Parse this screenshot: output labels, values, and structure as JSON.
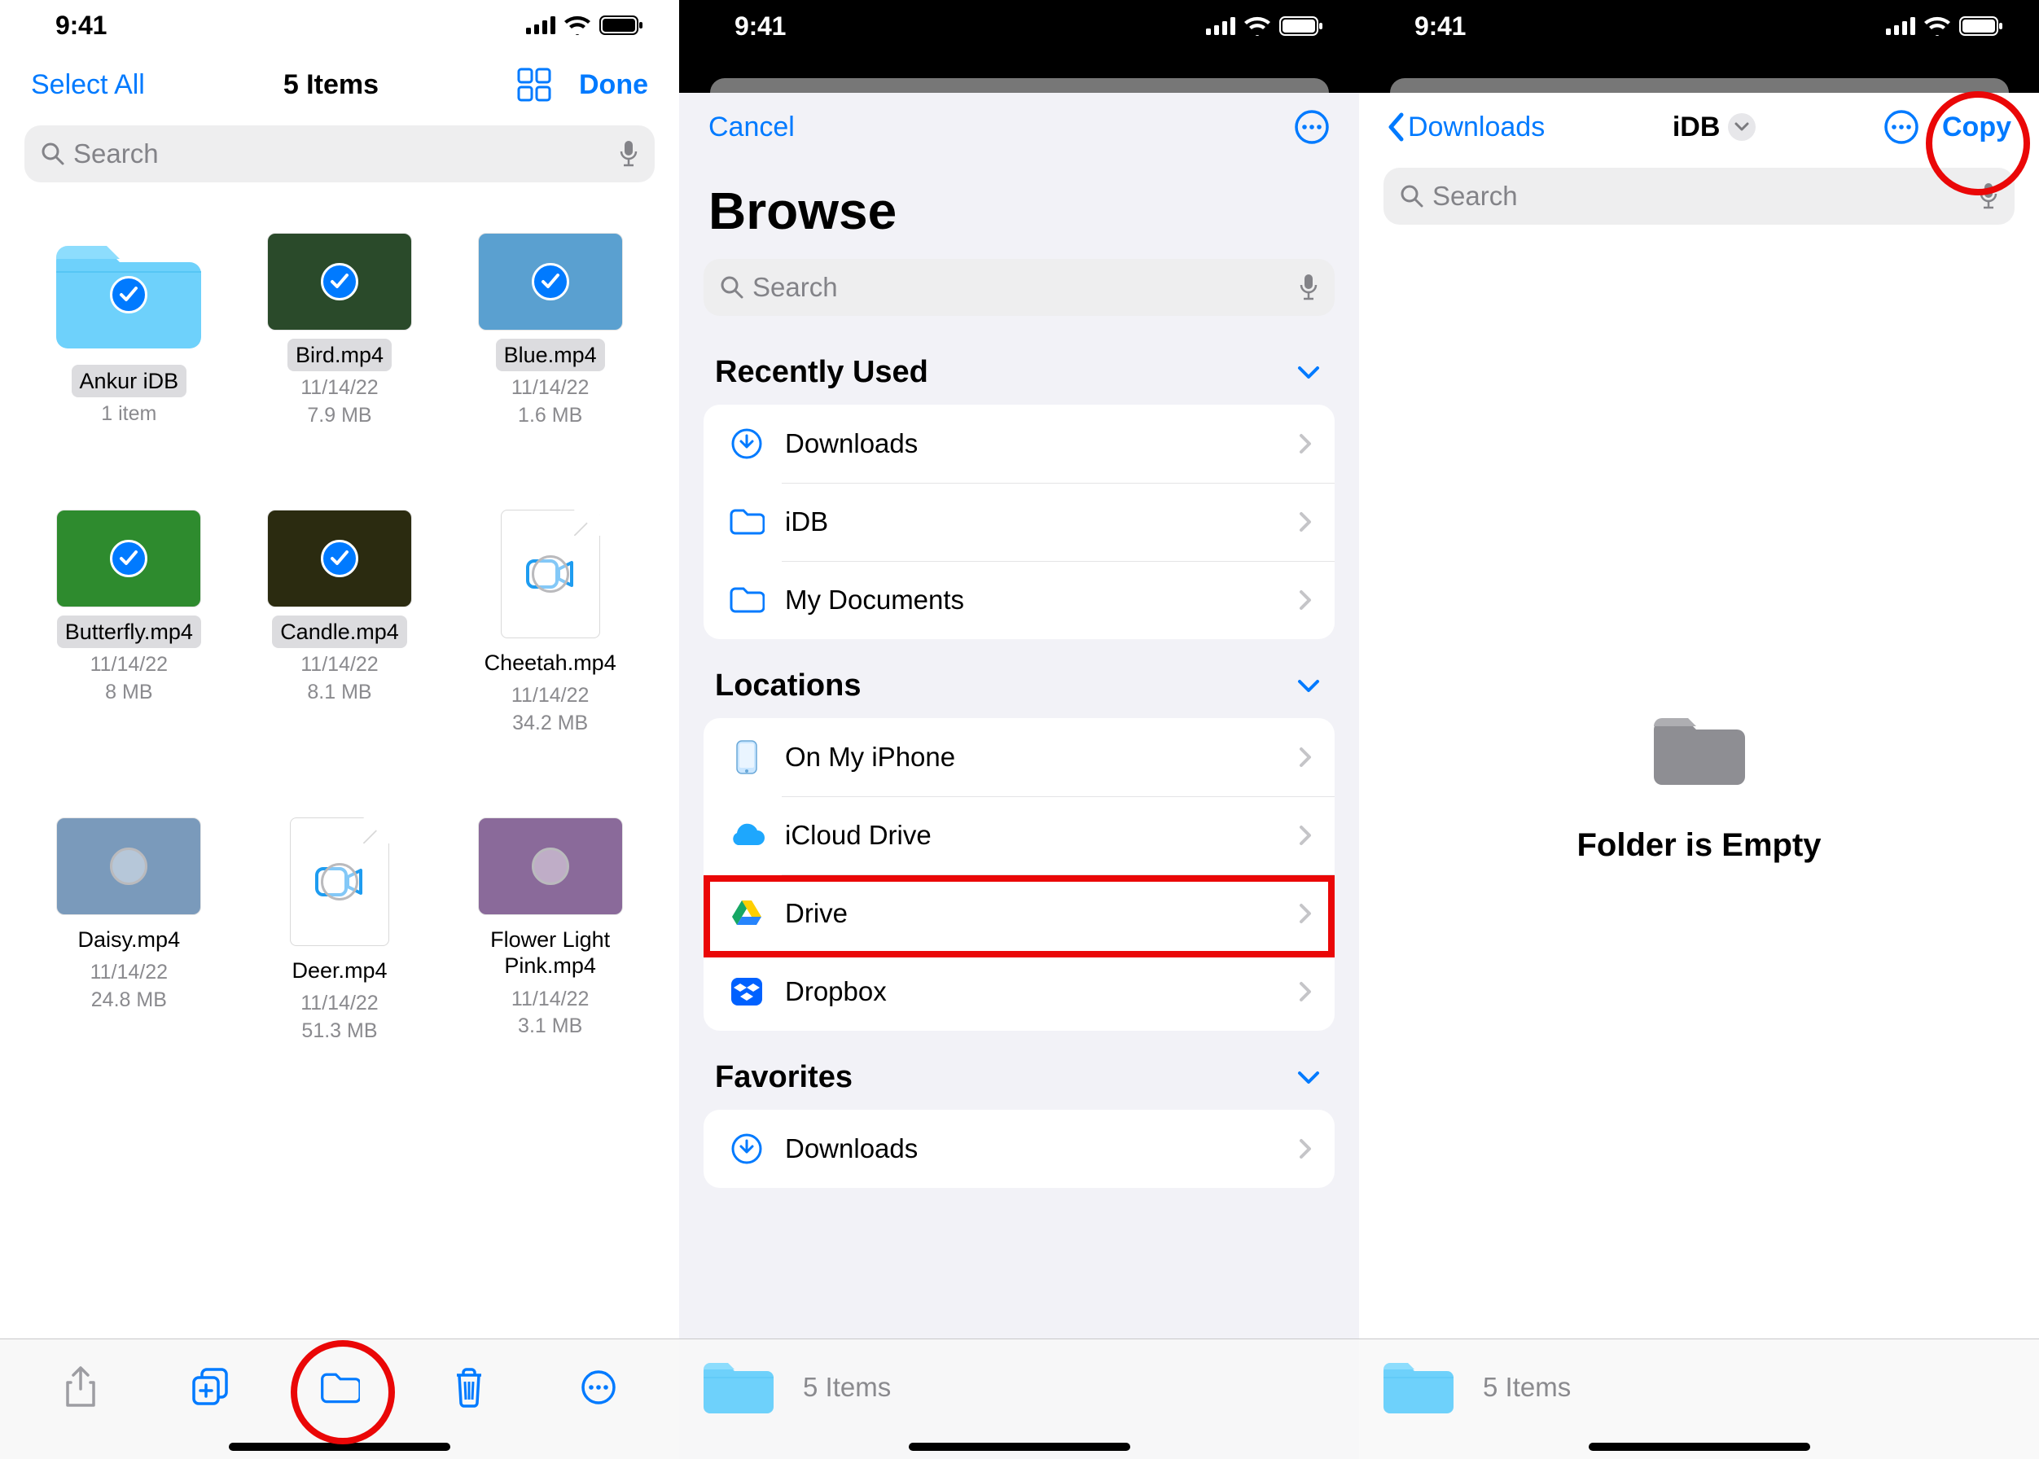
{
  "status": {
    "time": "9:41"
  },
  "panel1": {
    "select_all": "Select All",
    "title": "5 Items",
    "done": "Done",
    "search_placeholder": "Search",
    "items": [
      {
        "name": "Ankur iDB",
        "meta_l1": "1 item",
        "meta_l2": "",
        "kind": "folder",
        "selected": true
      },
      {
        "name": "Bird.mp4",
        "meta_l1": "11/14/22",
        "meta_l2": "7.9 MB",
        "kind": "video",
        "selected": true
      },
      {
        "name": "Blue.mp4",
        "meta_l1": "11/14/22",
        "meta_l2": "1.6 MB",
        "kind": "video",
        "selected": true
      },
      {
        "name": "Butterfly.mp4",
        "meta_l1": "11/14/22",
        "meta_l2": "8 MB",
        "kind": "video",
        "selected": true
      },
      {
        "name": "Candle.mp4",
        "meta_l1": "11/14/22",
        "meta_l2": "8.1 MB",
        "kind": "video",
        "selected": true
      },
      {
        "name": "Cheetah.mp4",
        "meta_l1": "11/14/22",
        "meta_l2": "34.2 MB",
        "kind": "file",
        "selected": false
      },
      {
        "name": "Daisy.mp4",
        "meta_l1": "11/14/22",
        "meta_l2": "24.8 MB",
        "kind": "video",
        "selected": false
      },
      {
        "name": "Deer.mp4",
        "meta_l1": "11/14/22",
        "meta_l2": "51.3 MB",
        "kind": "file",
        "selected": false
      },
      {
        "name": "Flower Light Pink.mp4",
        "meta_l1": "11/14/22",
        "meta_l2": "3.1 MB",
        "kind": "video",
        "selected": false
      }
    ]
  },
  "panel2": {
    "cancel": "Cancel",
    "title": "Browse",
    "search_placeholder": "Search",
    "recent_header": "Recently Used",
    "recent": [
      {
        "label": "Downloads",
        "icon": "download"
      },
      {
        "label": "iDB",
        "icon": "folder"
      },
      {
        "label": "My Documents",
        "icon": "folder"
      }
    ],
    "locations_header": "Locations",
    "locations": [
      {
        "label": "On My iPhone",
        "icon": "iphone"
      },
      {
        "label": "iCloud Drive",
        "icon": "icloud"
      },
      {
        "label": "Drive",
        "icon": "gdrive"
      },
      {
        "label": "Dropbox",
        "icon": "dropbox"
      }
    ],
    "favorites_header": "Favorites",
    "favorites": [
      {
        "label": "Downloads",
        "icon": "download"
      }
    ],
    "strip_label": "5 Items"
  },
  "panel3": {
    "back": "Downloads",
    "title": "iDB",
    "copy": "Copy",
    "search_placeholder": "Search",
    "empty": "Folder is Empty",
    "strip_label": "5 Items"
  }
}
